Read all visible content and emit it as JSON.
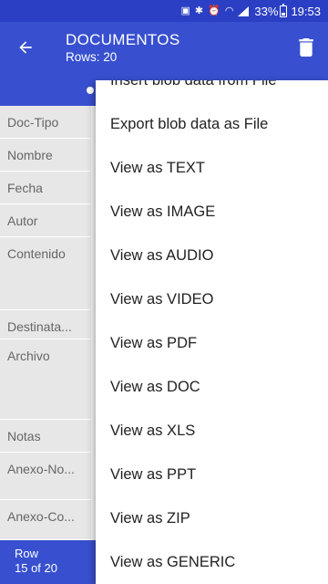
{
  "status_bar": {
    "battery": "33%",
    "time": "19:53"
  },
  "app_bar": {
    "title": "DOCUMENTOS",
    "subtitle": "Rows: 20"
  },
  "form": {
    "fields": [
      {
        "label": "Doc-Tipo"
      },
      {
        "label": "Nombre"
      },
      {
        "label": "Fecha"
      },
      {
        "label": "Autor"
      },
      {
        "label": "Contenido"
      },
      {
        "label": "Destinata..."
      },
      {
        "label": "Archivo"
      },
      {
        "label": "Notas"
      },
      {
        "label": "Anexo-No..."
      },
      {
        "label": "Anexo-Co..."
      }
    ]
  },
  "footer": {
    "line1": "Row",
    "line2": "15 of 20"
  },
  "menu": {
    "items": [
      {
        "label": "Insert blob data from File"
      },
      {
        "label": "Export blob data as File"
      },
      {
        "label": "View as TEXT"
      },
      {
        "label": "View as IMAGE"
      },
      {
        "label": "View as AUDIO"
      },
      {
        "label": "View as VIDEO"
      },
      {
        "label": "View as PDF"
      },
      {
        "label": "View as DOC"
      },
      {
        "label": "View as XLS"
      },
      {
        "label": "View as PPT"
      },
      {
        "label": "View as ZIP"
      },
      {
        "label": "View as GENERIC"
      }
    ]
  }
}
